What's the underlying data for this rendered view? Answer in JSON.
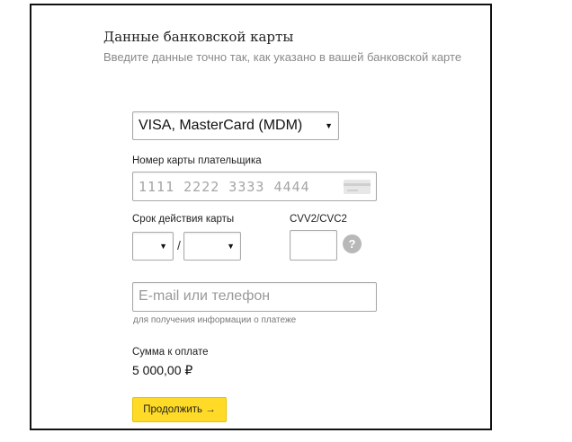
{
  "header": {
    "title": "Данные банковской карты",
    "subtitle": "Введите данные точно так, как указано в вашей банковской карте"
  },
  "payment_system": {
    "selected": "VISA, MasterCard (MDM)"
  },
  "card_number": {
    "label": "Номер карты плательщика",
    "placeholder": "1111 2222 3333 4444"
  },
  "expiry": {
    "label": "Срок действия карты",
    "month": "",
    "year": "",
    "separator": "/"
  },
  "cvv": {
    "label": "CVV2/CVC2",
    "help": "?"
  },
  "contact": {
    "placeholder": "E-mail или телефон",
    "hint": "для получения информации о платеже"
  },
  "amount": {
    "label": "Сумма к оплате",
    "value": "5 000,00 ₽"
  },
  "submit": {
    "label": "Продолжить →"
  },
  "colors": {
    "button": "#ffdb27",
    "help_badge": "#b8b8b8",
    "placeholder": "#999999"
  }
}
